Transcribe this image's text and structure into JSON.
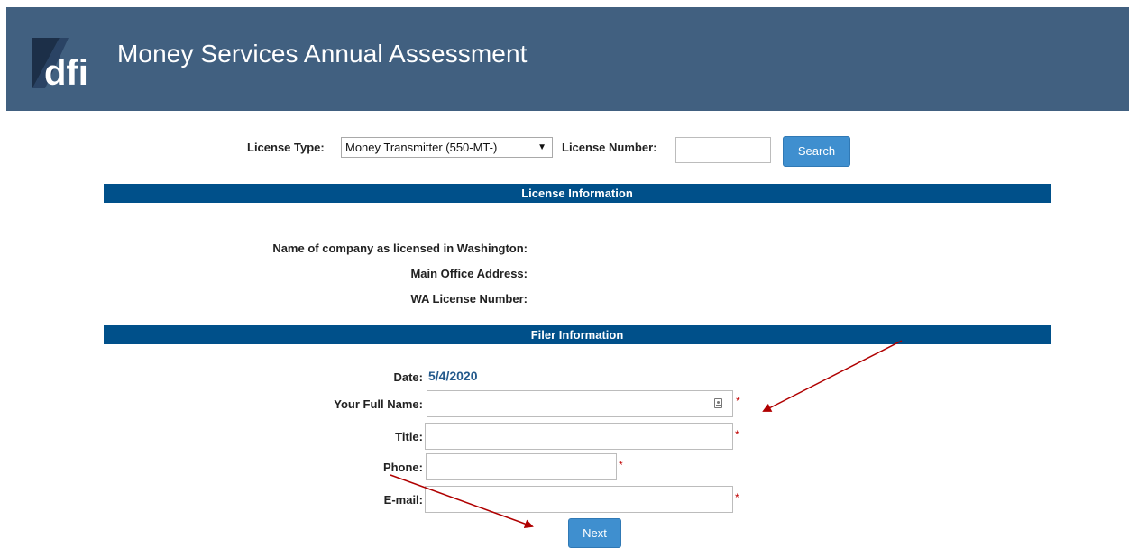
{
  "header": {
    "logo_text": "dfi",
    "title": "Money Services Annual Assessment"
  },
  "search": {
    "license_type_label": "License Type:",
    "license_type_selected": "Money Transmitter (550-MT-)",
    "license_number_label": "License Number:",
    "license_number_value": "",
    "search_button": "Search"
  },
  "license_info": {
    "section_title": "License Information",
    "company_name_label": "Name of company as licensed in Washington:",
    "main_office_label": "Main Office Address:",
    "wa_license_label": "WA License Number:"
  },
  "filer_info": {
    "section_title": "Filer Information",
    "date_label": "Date:",
    "date_value": "5/4/2020",
    "full_name_label": "Your Full Name:",
    "full_name_value": "",
    "title_label": "Title:",
    "title_value": "",
    "phone_label": "Phone:",
    "phone_value": "",
    "email_label": "E-mail:",
    "email_value": "",
    "required_marker": "*",
    "next_button": "Next"
  },
  "colors": {
    "header_bg": "#416080",
    "section_bar": "#00508a",
    "button": "#3f8fcf",
    "date_text": "#245a8c",
    "required": "#c00000",
    "annotation_arrow": "#b00000"
  }
}
